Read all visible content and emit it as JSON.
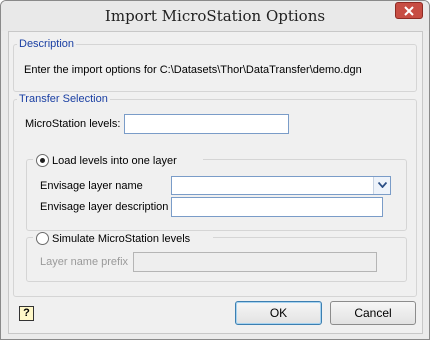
{
  "window": {
    "title": "Import MicroStation Options",
    "close_icon": "close-icon"
  },
  "description": {
    "legend": "Description",
    "text": "Enter the import options for C:\\Datasets\\Thor\\DataTransfer\\demo.dgn"
  },
  "transfer": {
    "legend": "Transfer Selection",
    "levels_label": "MicroStation levels:",
    "levels_value": "",
    "option_one_layer": {
      "label": "Load levels into one layer",
      "selected": true,
      "layer_name_label": "Envisage layer name",
      "layer_name_value": "",
      "layer_desc_label": "Envisage layer description",
      "layer_desc_value": ""
    },
    "option_simulate": {
      "label": "Simulate MicroStation levels",
      "selected": false,
      "prefix_label": "Layer name prefix",
      "prefix_value": ""
    }
  },
  "footer": {
    "help_icon": "help-icon",
    "ok_label": "OK",
    "cancel_label": "Cancel"
  }
}
